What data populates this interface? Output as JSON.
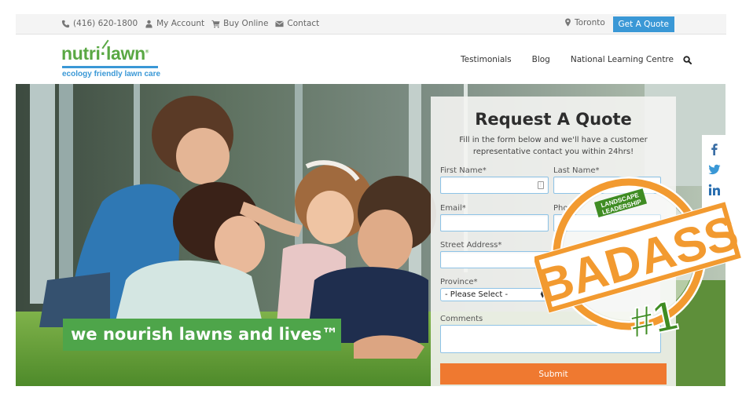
{
  "utility_bar": {
    "phone": {
      "label": "(416) 620-1800",
      "icon": "phone-icon"
    },
    "account": {
      "label": "My Account",
      "icon": "user-icon"
    },
    "buy_online": {
      "label": "Buy Online",
      "icon": "cart-icon"
    },
    "contact": {
      "label": "Contact",
      "icon": "envelope-icon"
    },
    "location": {
      "label": "Toronto",
      "icon": "map-pin-icon"
    },
    "get_quote_label": "Get A Quote"
  },
  "logo": {
    "wordmark": "nutri·lawn",
    "registered": "®",
    "tagline": "ecology friendly lawn care"
  },
  "nav": {
    "items": [
      {
        "label": "Testimonials"
      },
      {
        "label": "Blog"
      },
      {
        "label": "National Learning Centre"
      }
    ],
    "search_icon": "search-icon"
  },
  "hero": {
    "tagline": "we nourish lawns and lives™"
  },
  "quote_form": {
    "title": "Request A Quote",
    "subtitle": "Fill in the form below and we'll have a customer representative contact you within 24hrs!",
    "fields": {
      "first_name": {
        "label": "First Name*",
        "value": ""
      },
      "last_name": {
        "label": "Last Name*",
        "value": ""
      },
      "email": {
        "label": "Email*",
        "value": ""
      },
      "phone": {
        "label": "Phone",
        "value": ""
      },
      "street_address": {
        "label": "Street Address*",
        "value": ""
      },
      "province": {
        "label": "Province*",
        "selected": "- Please Select -"
      },
      "comments": {
        "label": "Comments",
        "value": ""
      }
    },
    "submit_label": "Submit"
  },
  "social": {
    "items": [
      {
        "name": "facebook",
        "icon": "facebook-icon",
        "glyph": "f"
      },
      {
        "name": "twitter",
        "icon": "twitter-icon"
      },
      {
        "name": "linkedin",
        "icon": "linkedin-icon",
        "glyph": "in"
      }
    ]
  },
  "badge": {
    "top_text_1": "LANDSCAPE",
    "top_text_2": "LEADERSHIP",
    "main_text": "BADASS",
    "rank": "#1"
  },
  "colors": {
    "brand_green": "#5aa844",
    "brand_blue": "#3a98d6",
    "tagline_green": "#4ea54a",
    "submit_orange": "#ef7930",
    "badge_orange": "#f29a30",
    "badge_green": "#3f8c23",
    "social_blue": "#3a6ea5"
  }
}
